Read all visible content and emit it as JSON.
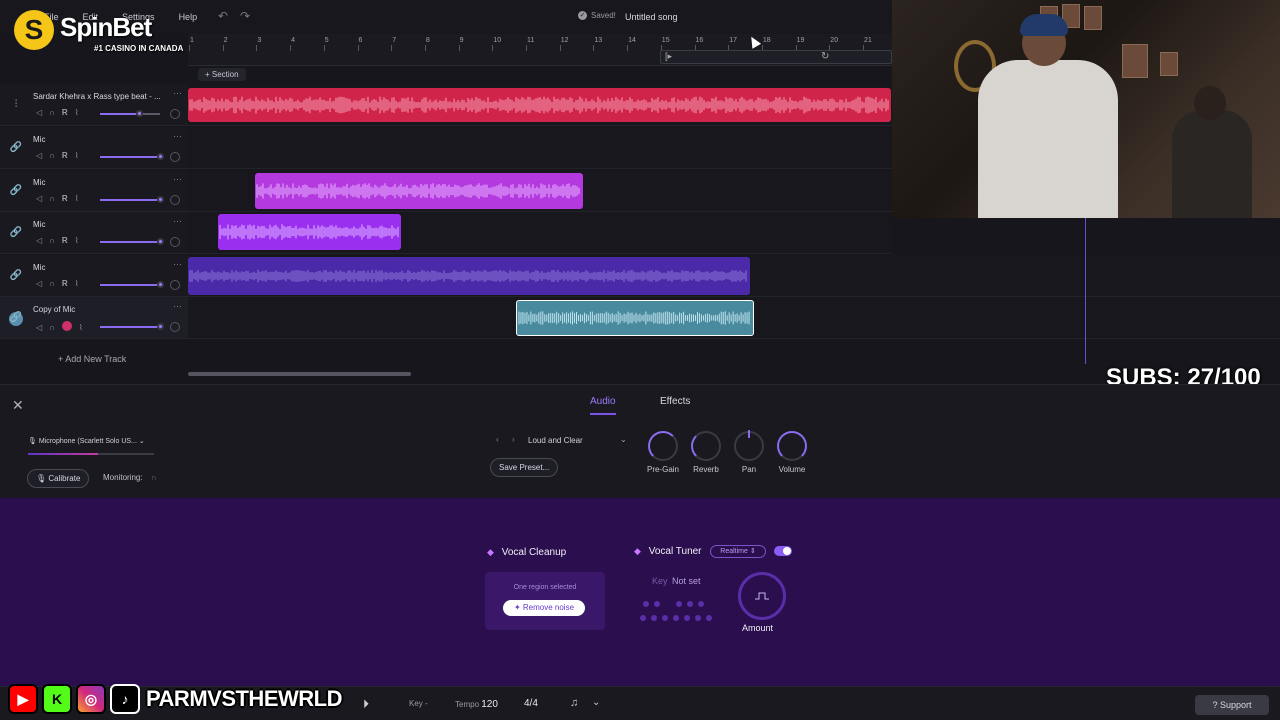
{
  "menu": [
    "File",
    "Edit",
    "Settings",
    "Help"
  ],
  "status": {
    "saved": "Saved!",
    "song_title": "Untitled song"
  },
  "ruler": {
    "ticks": [
      "1",
      "2",
      "3",
      "4",
      "5",
      "6",
      "7",
      "8",
      "9",
      "10",
      "11",
      "12",
      "13",
      "14",
      "15",
      "16",
      "17",
      "18",
      "19",
      "20",
      "21"
    ]
  },
  "section_button": "+ Section",
  "tracks": [
    {
      "name": "Sardar Khehra x Rass type beat - ...",
      "color": "#d1244a",
      "volume": 0.65
    },
    {
      "name": "Mic",
      "color": "#b43ae0",
      "volume": 1.0
    },
    {
      "name": "Mic",
      "color": "#b43ae0",
      "volume": 1.0
    },
    {
      "name": "Mic",
      "color": "#9b2ff0",
      "volume": 1.0
    },
    {
      "name": "Mic",
      "color": "#4a2aa8",
      "volume": 1.0
    },
    {
      "name": "Copy of Mic",
      "color": "#4a8a9e",
      "volume": 1.0
    }
  ],
  "add_track": "+ Add New Track",
  "subs": "SUBS: 27/100",
  "panel": {
    "tabs": [
      "Audio",
      "Effects"
    ],
    "input_device": "Microphone (Scarlett Solo US...",
    "calibrate": "Calibrate",
    "monitoring": "Monitoring:",
    "preset_name": "Loud and Clear",
    "save_preset": "Save Preset...",
    "knobs": [
      "Pre-Gain",
      "Reverb",
      "Pan",
      "Volume"
    ]
  },
  "features": {
    "vocal_cleanup": "Vocal Cleanup",
    "region_info": "One region selected",
    "remove_noise": "Remove noise",
    "vocal_tuner": "Vocal Tuner",
    "tuner_mode": "Realtime",
    "key_label": "Key",
    "key_value": "Not set",
    "amount": "Amount"
  },
  "transport": {
    "key_label": "Key",
    "key_value": "-",
    "tempo_label": "Tempo",
    "tempo_value": "120",
    "time_sig": "4/4"
  },
  "support": "Support",
  "overlay": {
    "brand": "SpinBet",
    "brand_letter": "S",
    "tagline": "#1 CASINO IN CANADA",
    "handle": "PARMVSTHEWRLD"
  }
}
